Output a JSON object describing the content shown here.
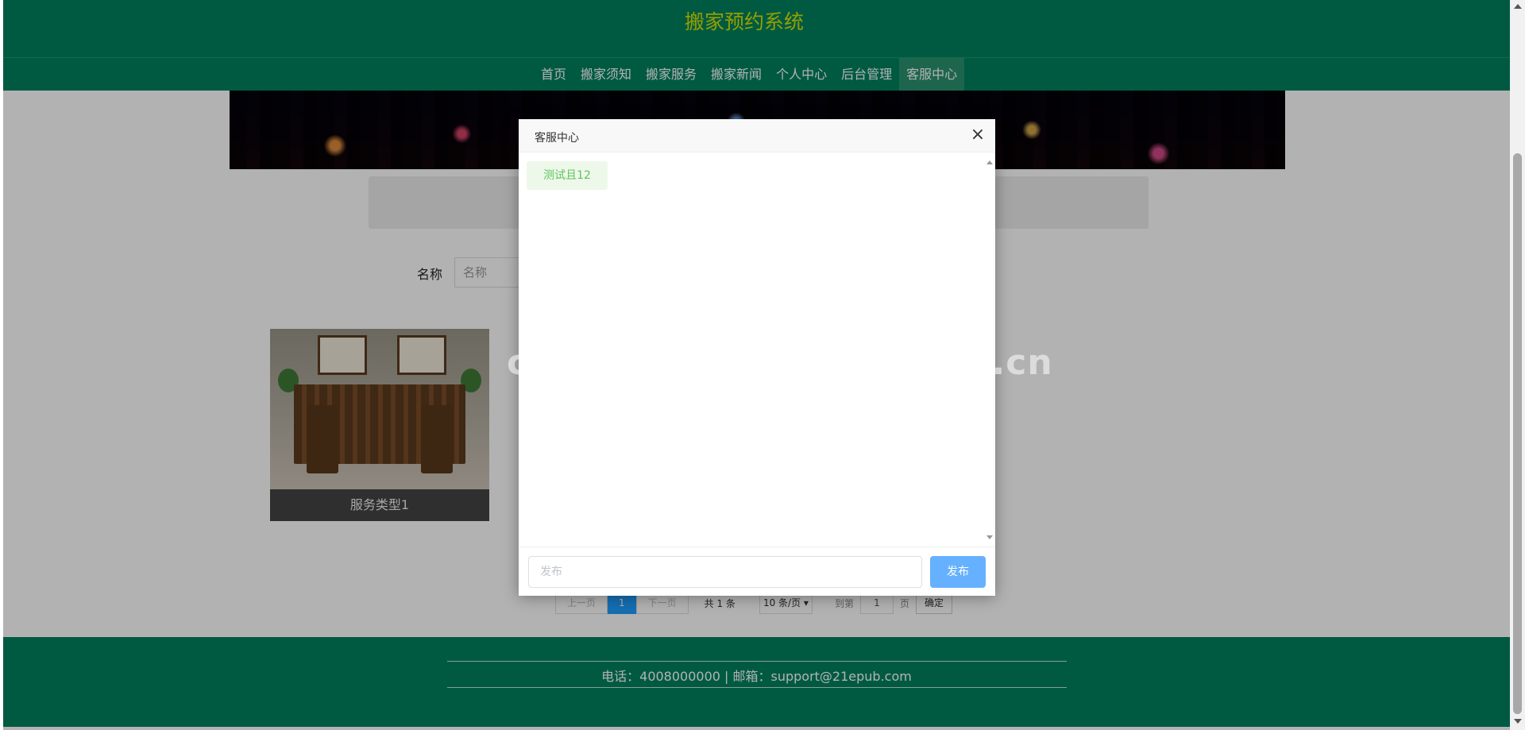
{
  "header": {
    "site_title": "搬家预约系统"
  },
  "nav": {
    "items": [
      {
        "label": "首页",
        "active": false
      },
      {
        "label": "搬家须知",
        "active": false
      },
      {
        "label": "搬家服务",
        "active": false
      },
      {
        "label": "搬家新闻",
        "active": false
      },
      {
        "label": "个人中心",
        "active": false
      },
      {
        "label": "后台管理",
        "active": false
      },
      {
        "label": "客服中心",
        "active": true
      }
    ]
  },
  "search": {
    "label": "名称",
    "placeholder": "名称"
  },
  "products": [
    {
      "caption": "服务类型1"
    }
  ],
  "pagination": {
    "prev_label": "上一页",
    "current_page": "1",
    "next_label": "下一页",
    "total_text": "共 1 条",
    "page_size": "10 条/页",
    "goto_label": "到第",
    "goto_value": "1",
    "page_label": "页",
    "confirm_label": "确定"
  },
  "footer": {
    "contact": "电话：4008000000 | 邮箱：support@21epub.com"
  },
  "modal": {
    "title": "客服中心",
    "close_icon": "close-icon",
    "messages": [
      {
        "text": "测试且12"
      }
    ],
    "input_placeholder": "发布",
    "send_label": "发布"
  },
  "watermark": "cn围观客www.weiguanke.cn",
  "colors": {
    "primary_green": "#00825f",
    "title_yellow": "#d4e300",
    "send_button": "#66b1ff",
    "page_active": "#1e9fff",
    "chat_bubble_text": "#5ec45e"
  }
}
